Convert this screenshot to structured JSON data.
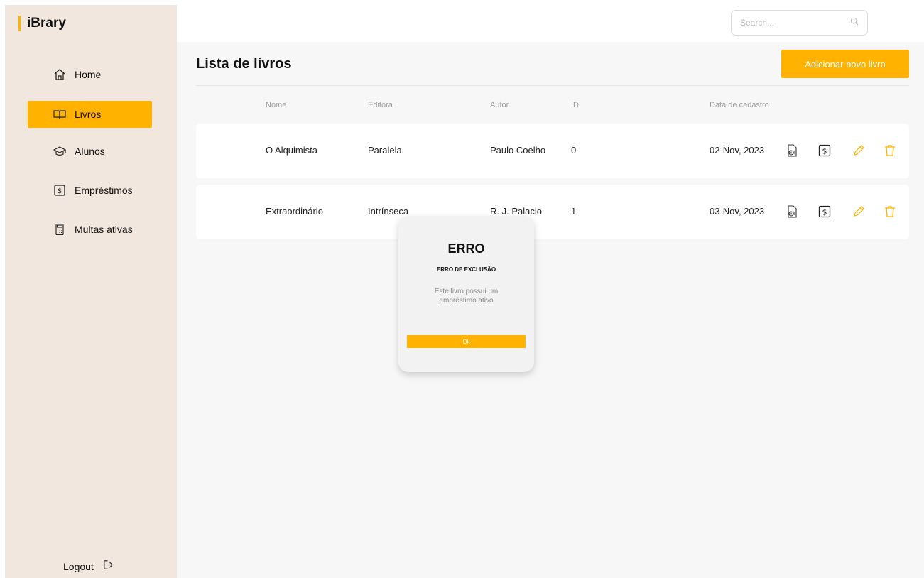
{
  "brand": "iBrary",
  "accent_color": "#ffb200",
  "sidebar": {
    "items": [
      {
        "label": "Home",
        "icon": "home-icon",
        "active": false
      },
      {
        "label": "Livros",
        "icon": "book-icon",
        "active": true
      },
      {
        "label": "Alunos",
        "icon": "graduation-cap-icon",
        "active": false
      },
      {
        "label": "Empréstimos",
        "icon": "dollar-box-icon",
        "active": false
      },
      {
        "label": "Multas ativas",
        "icon": "calculator-icon",
        "active": false
      }
    ],
    "logout": "Logout"
  },
  "search": {
    "placeholder": "Search..."
  },
  "main": {
    "title": "Lista de livros",
    "add_button": "Adicionar novo livro",
    "columns": [
      "Nome",
      "Editora",
      "Autor",
      "ID",
      "Data de cadastro"
    ],
    "rows": [
      {
        "nome": "O Alquimista",
        "editora": "Paralela",
        "autor": "Paulo Coelho",
        "id": "0",
        "data": "02-Nov, 2023"
      },
      {
        "nome": "Extraordinário",
        "editora": "Intrínseca",
        "autor": "R. J. Palacio",
        "id": "1",
        "data": "03-Nov, 2023"
      }
    ]
  },
  "modal": {
    "title": "ERRO",
    "subtitle": "ERRO DE EXCLUSÃO",
    "message": "Este livro possui um empréstimo ativo",
    "ok": "Ok"
  }
}
